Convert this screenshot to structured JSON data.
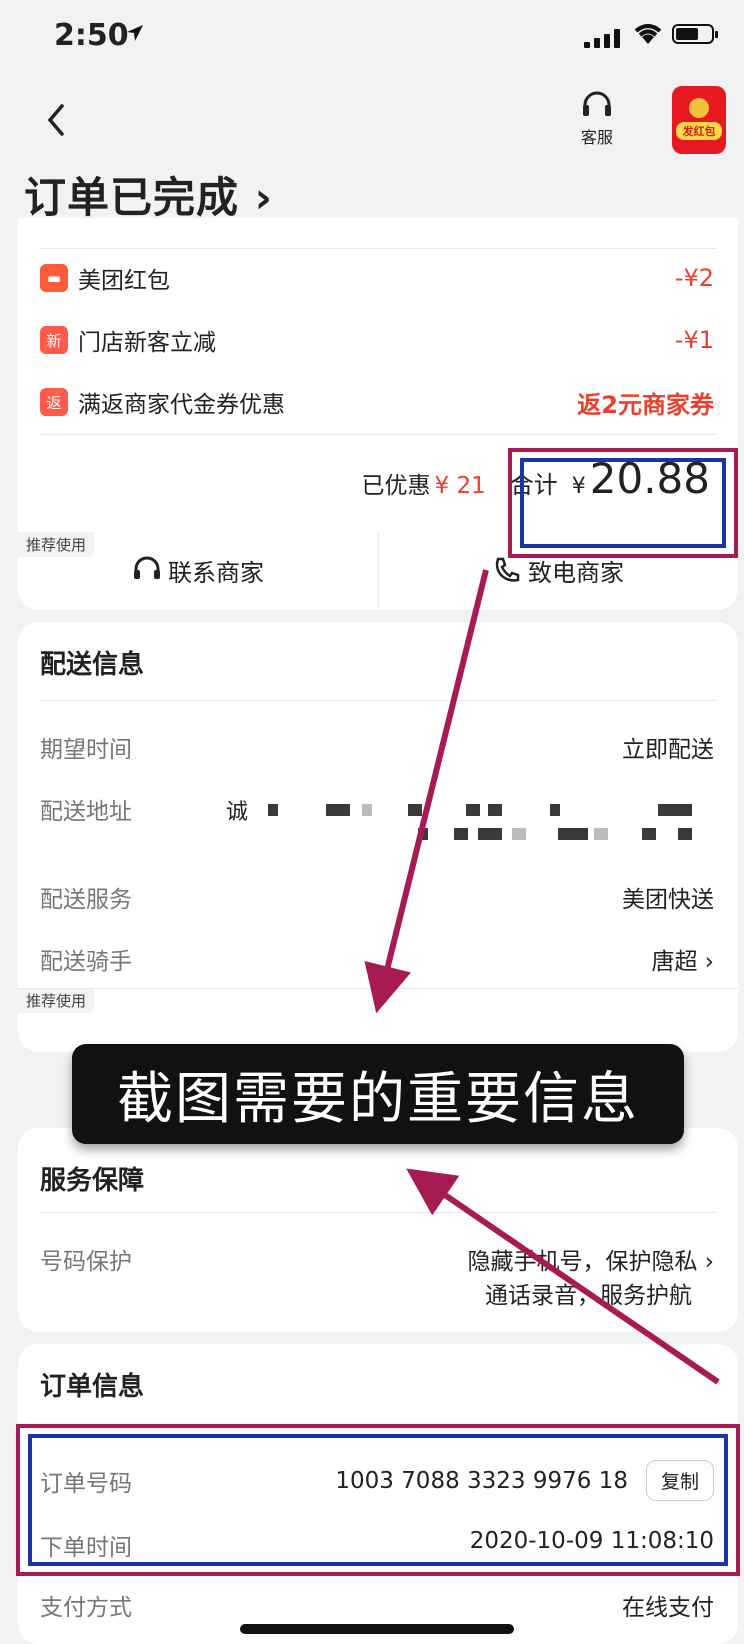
{
  "status_bar": {
    "time": "2:50"
  },
  "nav": {
    "customer_service_label": "客服",
    "red_packet_label": "发红包"
  },
  "page": {
    "title": "订单已完成 ›"
  },
  "discounts": [
    {
      "icon": "",
      "label": "美团红包",
      "value": "-¥2"
    },
    {
      "icon": "新",
      "label": "门店新客立减",
      "value": "-¥1"
    },
    {
      "icon": "返",
      "label": "满返商家代金券优惠",
      "value": "返2元商家券"
    }
  ],
  "summary": {
    "saved_label": "已优惠",
    "saved_value": "¥ 21",
    "total_label": "合计",
    "currency": "¥",
    "total_amount": "20.88"
  },
  "contact": {
    "recommend_tag": "推荐使用",
    "contact_merchant": "联系商家",
    "call_merchant": "致电商家"
  },
  "delivery": {
    "title": "配送信息",
    "rows": [
      {
        "key": "期望时间",
        "value": "立即配送"
      },
      {
        "key": "配送地址",
        "value": ""
      },
      {
        "key": "配送服务",
        "value": "美团快送"
      },
      {
        "key": "配送骑手",
        "value": "唐超 ›"
      }
    ],
    "address_partial": "诚",
    "recommend_tag": "推荐使用"
  },
  "service": {
    "title": "服务保障",
    "row_key": "号码保护",
    "row_value_line1": "隐藏手机号，保护隐私 ›",
    "row_value_line2": "通话录音，服务护航"
  },
  "order_info": {
    "title": "订单信息",
    "rows": [
      {
        "key": "订单号码",
        "value": "1003 7088 3323 9976 18"
      },
      {
        "key": "下单时间",
        "value": "2020-10-09 11:08:10"
      },
      {
        "key": "支付方式",
        "value": "在线支付"
      }
    ],
    "copy_label": "复制"
  },
  "annotation": {
    "banner_text": "截图需要的重要信息"
  },
  "colors": {
    "accent_red": "#e8422f",
    "annotation_red": "#a71b55",
    "annotation_blue": "#1a35a8"
  }
}
